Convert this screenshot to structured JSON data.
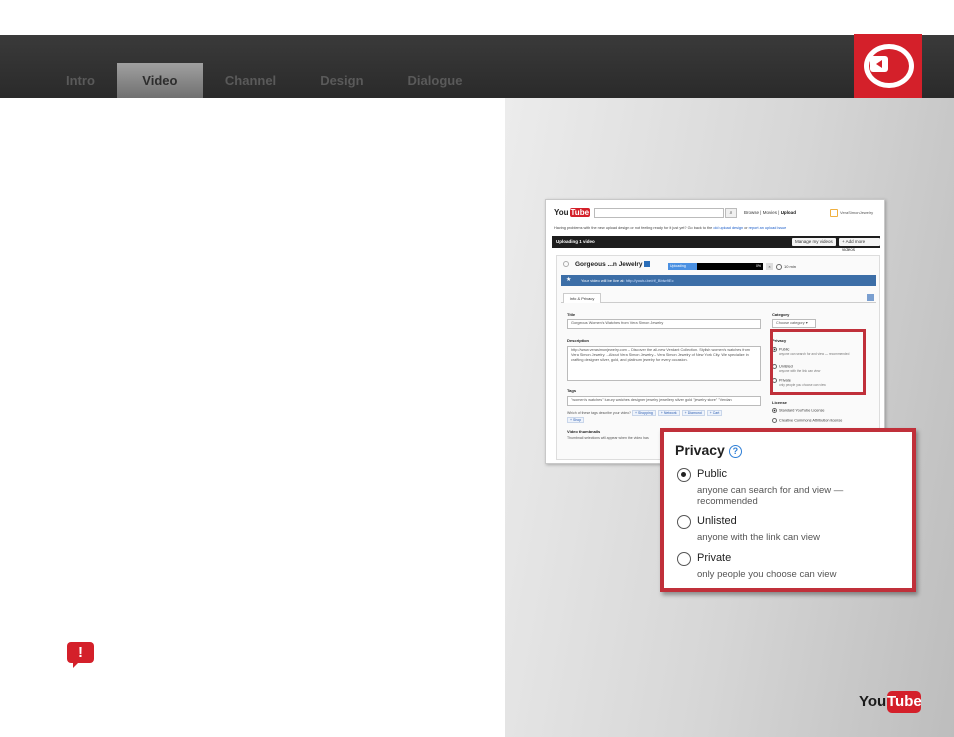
{
  "nav": {
    "tabs": [
      {
        "label": "Intro",
        "active": false
      },
      {
        "label": "Video",
        "active": true
      },
      {
        "label": "Channel",
        "active": false
      },
      {
        "label": "Design",
        "active": false
      },
      {
        "label": "Dialogue",
        "active": false
      }
    ]
  },
  "brand": {
    "accent": "#d4202a",
    "logo_you": "You",
    "logo_tube": "Tube"
  },
  "alert_icon": {
    "symbol": "!",
    "icon": "alert-speech-icon"
  },
  "screenshot": {
    "logo_you": "You",
    "logo_tube": "Tube",
    "search_icon": "search-icon",
    "nav": {
      "browse": "Browse",
      "sep": "|",
      "movies": "Movies",
      "upload": "Upload"
    },
    "user": "VeraSimonJewelry",
    "warning": "Having problems with the new upload design or not feeling ready for it just yet? Go back to the",
    "warning_link1": "old upload design",
    "warning_or": "or",
    "warning_link2": "report an upload issue",
    "uploading_label": "Uploading 1 video",
    "manage_btn": "Manage my videos",
    "add_btn": "+ Add more videos",
    "video_title": "Gorgeous ...n Jewelry",
    "progress_label": "Uploading",
    "progress_pct": "0%",
    "progress_value": 0.3,
    "close": "×",
    "time_left": "10 min",
    "live_text": "Your video will be live at:",
    "live_url": "http://youtu.be/rlf_Bbtw9Ec",
    "tab": "Info & Privacy",
    "title_label": "Title",
    "title_value": "Gorgeous Women's Watches from Vera Simon Jewelry",
    "description_label": "Description",
    "description_value": "http://www.verasimonjewelry.com – Discover the all-new Verdant Collection. Stylish women's watches from Vera Simon Jewelry. --About Vera Simon Jewelry-- Vera Simon Jewelry of New York City. We specialize in crafting designer silver, gold, and platinum jewelry for every occasion.",
    "tags_label": "Tags",
    "tags_value": "\"women's watches\" luxury watches designer jewelry jewellery silver gold \"jewelry store\" \"Verdan",
    "tags_prompt": "Which of these tags describe your video?",
    "tag_chips": [
      "+ Shopping",
      "+ Network",
      "+ Diamond",
      "+ Cart",
      "+ Shop"
    ],
    "thumbs_label": "Video thumbnails",
    "thumbs_note": "Thumbnail selections will appear when the video has",
    "category_label": "Category",
    "category_value": "Choose category ▾",
    "privacy_label": "Privacy",
    "privacy_options": [
      {
        "name": "Public",
        "desc": "anyone can search for and view — recommended",
        "selected": true
      },
      {
        "name": "Unlisted",
        "desc": "anyone with the link can view",
        "selected": false
      },
      {
        "name": "Private",
        "desc": "only people you choose can view",
        "selected": false
      }
    ],
    "license_label": "License",
    "license_options": [
      {
        "name": "Standard YouTube License",
        "selected": true
      },
      {
        "name": "Creative Commons Attribution license",
        "selected": false
      }
    ]
  },
  "zoom": {
    "title": "Privacy",
    "help_icon": "?",
    "options": [
      {
        "name": "Public",
        "desc_line1": "anyone can search for and view —",
        "desc_line2": "recommended",
        "selected": true
      },
      {
        "name": "Unlisted",
        "desc_line1": "anyone with the link can view",
        "desc_line2": "",
        "selected": false
      },
      {
        "name": "Private",
        "desc_line1": "only people you choose can view",
        "desc_line2": "",
        "selected": false
      }
    ]
  }
}
